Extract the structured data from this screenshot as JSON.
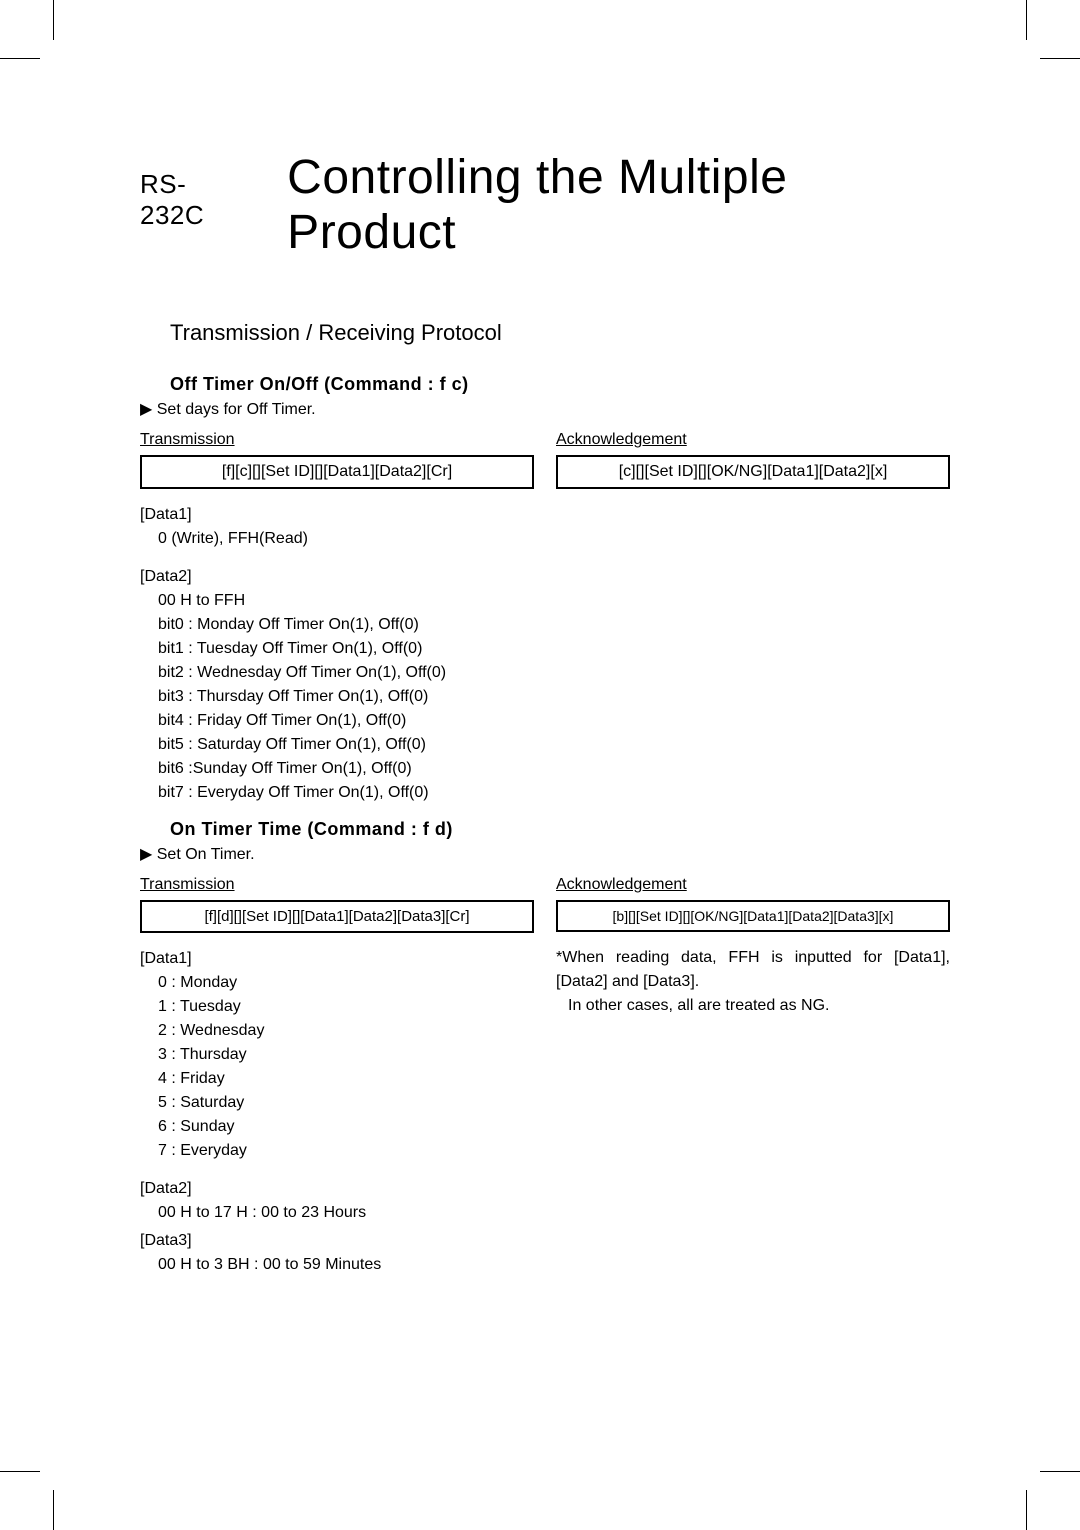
{
  "title": {
    "small": "RS-232C",
    "big": "Controlling the Multiple Product"
  },
  "subtitle": "Transmission / Receiving Protocol",
  "cmd1": {
    "heading": "Off Timer On/Off (Command : f c)",
    "desc": "▶ Set days for Off Timer.",
    "trans_head": "Transmission",
    "trans_code": "[f][c][][Set ID][][Data1][Data2][Cr]",
    "ack_head": "Acknowledgement",
    "ack_code": "[c][][Set ID][][OK/NG][Data1][Data2][x]",
    "data1_label": "[Data1]",
    "data1_line": "0 (Write), FFH(Read)",
    "data2_label": "[Data2]",
    "data2_lines": [
      "00 H to FFH",
      "bit0 : Monday Off Timer On(1), Off(0)",
      "bit1 : Tuesday Off Timer On(1), Off(0)",
      "bit2 : Wednesday Off Timer On(1), Off(0)",
      "bit3 : Thursday Off Timer On(1), Off(0)",
      "bit4 : Friday Off Timer On(1), Off(0)",
      "bit5 : Saturday Off Timer On(1), Off(0)",
      "bit6 :Sunday Off Timer On(1), Off(0)",
      "bit7 : Everyday Off Timer On(1), Off(0)"
    ]
  },
  "cmd2": {
    "heading": "On Timer Time (Command : f d)",
    "desc": "▶ Set On Timer.",
    "trans_head": "Transmission",
    "trans_code": "[f][d][][Set ID][][Data1][Data2][Data3][Cr]",
    "ack_head": "Acknowledgement",
    "ack_code": "[b][][Set ID][][OK/NG][Data1][Data2][Data3][x]",
    "data1_label": "[Data1]",
    "data1_lines": [
      "0 : Monday",
      "1 : Tuesday",
      "2 : Wednesday",
      "3 : Thursday",
      "4 : Friday",
      "5 : Saturday",
      "6 : Sunday",
      "7 : Everyday"
    ],
    "data2_label": "[Data2]",
    "data2_line": "00 H to 17 H : 00 to 23 Hours",
    "data3_label": "[Data3]",
    "data3_line": "00 H to 3 BH : 00 to 59 Minutes",
    "note1": "*When reading data, FFH is inputted for [Data1], [Data2] and [Data3].",
    "note2": "In other cases, all are treated as NG."
  }
}
